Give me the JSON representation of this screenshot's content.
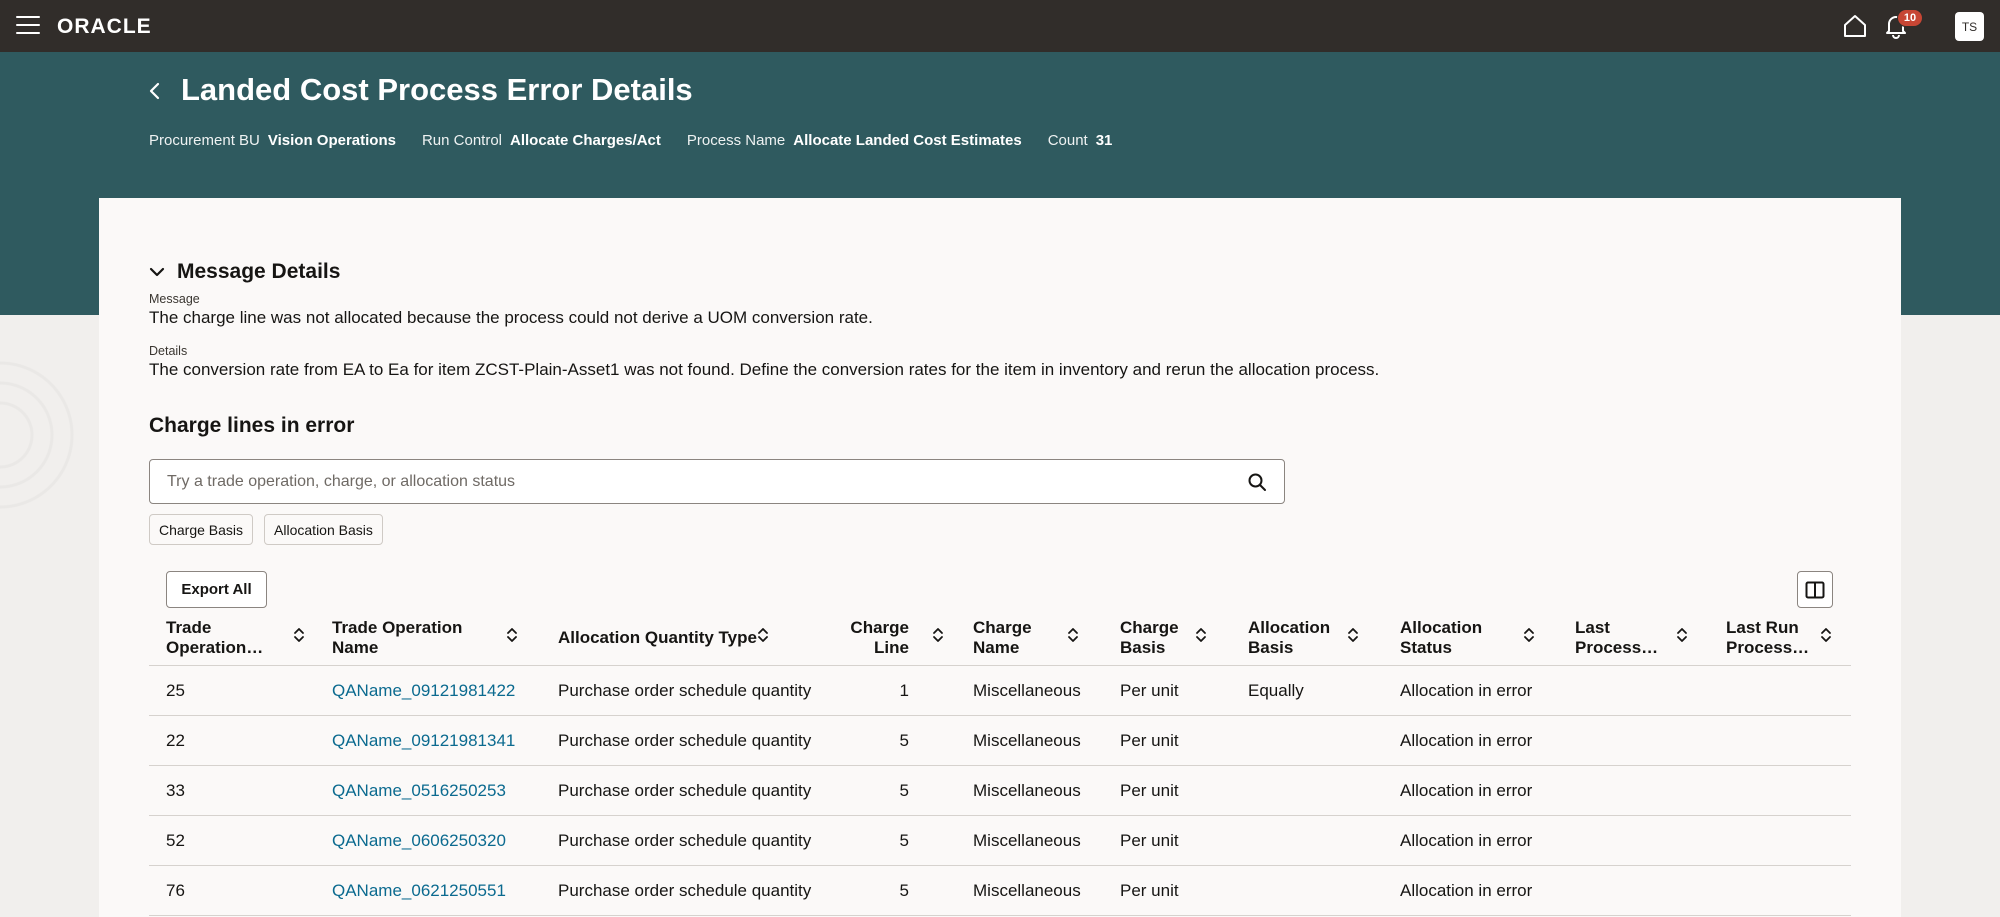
{
  "topbar": {
    "brand": "ORACLE",
    "notification_count": "10",
    "user_initials": "TS"
  },
  "header": {
    "title": "Landed Cost Process Error Details",
    "meta": [
      {
        "label": "Procurement BU",
        "value": "Vision Operations"
      },
      {
        "label": "Run Control",
        "value": "Allocate Charges/Act"
      },
      {
        "label": "Process Name",
        "value": "Allocate Landed Cost Estimates"
      },
      {
        "label": "Count",
        "value": "31"
      }
    ]
  },
  "message_details": {
    "section_title": "Message Details",
    "message_label": "Message",
    "message_value": "The charge line was not allocated because the process could not derive a UOM conversion rate.",
    "details_label": "Details",
    "details_value": "The conversion rate from EA to Ea for item ZCST-Plain-Asset1 was not found. Define the conversion rates for the item in inventory and rerun the allocation process."
  },
  "charge_lines": {
    "title": "Charge lines in error",
    "search_placeholder": "Try a trade operation, charge, or allocation status",
    "chips": [
      "Charge Basis",
      "Allocation Basis"
    ],
    "export_label": "Export All",
    "columns": [
      {
        "l1": "Trade",
        "l2": "Operation…"
      },
      {
        "l1": "Trade Operation",
        "l2": "Name"
      },
      {
        "l1": "Allocation Quantity Type",
        "l2": ""
      },
      {
        "l1": "Charge",
        "l2": "Line"
      },
      {
        "l1": "Charge",
        "l2": "Name"
      },
      {
        "l1": "Charge",
        "l2": "Basis"
      },
      {
        "l1": "Allocation",
        "l2": "Basis"
      },
      {
        "l1": "Allocation",
        "l2": "Status"
      },
      {
        "l1": "Last",
        "l2": "Process…"
      },
      {
        "l1": "Last Run",
        "l2": "Process…"
      }
    ],
    "rows": [
      {
        "trade_op": "25",
        "name": "QAName_09121981422",
        "qty_type": "Purchase order schedule quantity",
        "line": "1",
        "charge_name": "Miscellaneous",
        "charge_basis": "Per unit",
        "alloc_basis": "Equally",
        "status": "Allocation in error"
      },
      {
        "trade_op": "22",
        "name": "QAName_09121981341",
        "qty_type": "Purchase order schedule quantity",
        "line": "5",
        "charge_name": "Miscellaneous",
        "charge_basis": "Per unit",
        "alloc_basis": "",
        "status": "Allocation in error"
      },
      {
        "trade_op": "33",
        "name": "QAName_0516250253",
        "qty_type": "Purchase order schedule quantity",
        "line": "5",
        "charge_name": "Miscellaneous",
        "charge_basis": "Per unit",
        "alloc_basis": "",
        "status": "Allocation in error"
      },
      {
        "trade_op": "52",
        "name": "QAName_0606250320",
        "qty_type": "Purchase order schedule quantity",
        "line": "5",
        "charge_name": "Miscellaneous",
        "charge_basis": "Per unit",
        "alloc_basis": "",
        "status": "Allocation in error"
      },
      {
        "trade_op": "76",
        "name": "QAName_0621250551",
        "qty_type": "Purchase order schedule quantity",
        "line": "5",
        "charge_name": "Miscellaneous",
        "charge_basis": "Per unit",
        "alloc_basis": "",
        "status": "Allocation in error"
      }
    ]
  },
  "colors": {
    "topbar": "#312d2a",
    "header_band": "#2f5a5f",
    "link": "#0b6a8f",
    "badge": "#c74634"
  }
}
